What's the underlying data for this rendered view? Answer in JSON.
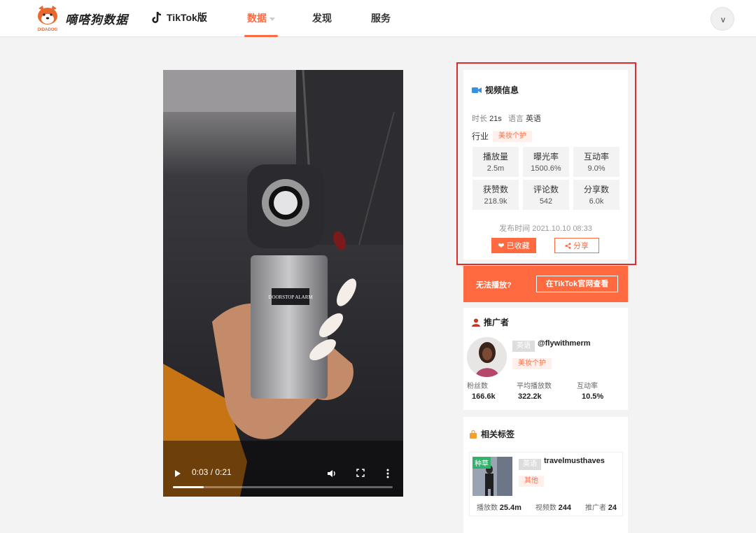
{
  "header": {
    "brand_name": "嘀嗒狗数据",
    "brand_sub": "DIDADOG",
    "platform_label": "TikTok版",
    "nav": [
      {
        "label": "数据",
        "active": true
      },
      {
        "label": "发现",
        "active": false
      },
      {
        "label": "服务",
        "active": false
      }
    ],
    "user_initial": "V"
  },
  "video": {
    "time_display": "0:03 / 0:21",
    "progress": 0.14,
    "product_label": "DOORSTOP ALARM"
  },
  "video_info": {
    "title": "视频信息",
    "duration_label": "时长",
    "duration_value": "21s",
    "language_label": "语言",
    "language_value": "英语",
    "industry_label": "行业",
    "industry_value": "美妆个护",
    "stats": [
      {
        "label": "播放量",
        "value": "2.5m"
      },
      {
        "label": "曝光率",
        "value": "1500.6%"
      },
      {
        "label": "互动率",
        "value": "9.0%"
      },
      {
        "label": "获赞数",
        "value": "218.9k"
      },
      {
        "label": "评论数",
        "value": "542"
      },
      {
        "label": "分享数",
        "value": "6.0k"
      }
    ],
    "publish_label": "发布时间",
    "publish_time": "2021.10.10 08:33",
    "favorite_label": "已收藏",
    "share_label": "分享"
  },
  "cant_play": {
    "text": "无法播放?",
    "button_label": "在TikTok官网查看"
  },
  "promoter": {
    "title": "推广者",
    "language": "英语",
    "username": "@flywithmerm",
    "industry": "美妆个护",
    "stats": [
      {
        "label": "粉丝数",
        "value": "166.6k"
      },
      {
        "label": "平均播放数",
        "value": "322.2k"
      },
      {
        "label": "互动率",
        "value": "10.5%"
      }
    ]
  },
  "related_tags": {
    "title": "相关标签",
    "items": [
      {
        "badge": "种草",
        "language": "英语",
        "name": "travelmusthaves",
        "category": "其他",
        "plays_label": "播放数",
        "plays": "25.4m",
        "videos_label": "视频数",
        "videos": "244",
        "promoters_label": "推广者",
        "promoters": "24"
      }
    ]
  },
  "colors": {
    "accent": "#ff6a41",
    "highlight_border": "#e32a2a",
    "tag_green": "#2fb36b"
  }
}
